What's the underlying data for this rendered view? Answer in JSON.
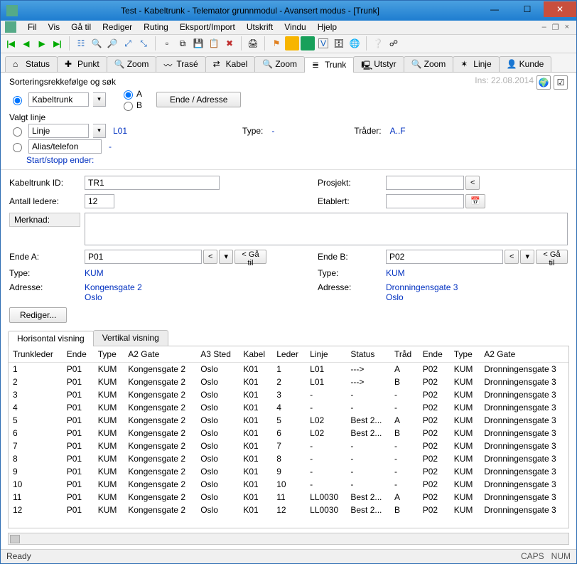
{
  "titlebar": {
    "text": "Test - Kabeltrunk - Telemator grunnmodul - Avansert modus - [Trunk]"
  },
  "menu": [
    "Fil",
    "Vis",
    "Gå til",
    "Rediger",
    "Ruting",
    "Eksport/Import",
    "Utskrift",
    "Vindu",
    "Hjelp"
  ],
  "tabs": [
    {
      "label": "Status"
    },
    {
      "label": "Punkt"
    },
    {
      "label": "Zoom"
    },
    {
      "label": "Trasé"
    },
    {
      "label": "Kabel"
    },
    {
      "label": "Zoom"
    },
    {
      "label": "Trunk",
      "active": true
    },
    {
      "label": "Utstyr"
    },
    {
      "label": "Zoom"
    },
    {
      "label": "Linje"
    },
    {
      "label": "Kunde"
    }
  ],
  "sort": {
    "heading": "Sorteringsrekkefølge og søk",
    "kabeltrunk": "Kabeltrunk",
    "A": "A",
    "B": "B",
    "ende_adresse_btn": "Ende / Adresse",
    "valgt": "Valgt linje",
    "linje": "Linje",
    "linje_val": "L01",
    "alias": "Alias/telefon",
    "alias_val": "-",
    "type_label": "Type:",
    "type_val": "-",
    "trader_label": "Tråder:",
    "trader_val": "A..F",
    "startstopp": "Start/stopp ender:",
    "insert": "Ins: 22.08.2014"
  },
  "form": {
    "kabeltrunk_id_label": "Kabeltrunk ID:",
    "kabeltrunk_id": "TR1",
    "prosjekt_label": "Prosjekt:",
    "prosjekt": "",
    "prosjekt_btn": "<",
    "antall_label": "Antall ledere:",
    "antall": "12",
    "etablert_label": "Etablert:",
    "etablert": "",
    "merknad_label": "Merknad:",
    "merknad": "",
    "endeA_label": "Ende A:",
    "endeA": "P01",
    "ga_til": "< Gå til",
    "lt": "<",
    "dd": "▾",
    "endeB_label": "Ende B:",
    "endeB": "P02",
    "type_label": "Type:",
    "adresse_label": "Adresse:",
    "A_type": "KUM",
    "A_addr1": "Kongensgate 2",
    "A_addr2": "Oslo",
    "B_type": "KUM",
    "B_addr1": "Dronningensgate 3",
    "B_addr2": "Oslo",
    "rediger": "Rediger..."
  },
  "viewtabs": {
    "horisontal": "Horisontal visning",
    "vertikal": "Vertikal visning"
  },
  "columns": [
    "Trunkleder",
    "Ende",
    "Type",
    "A2 Gate",
    "A3 Sted",
    "Kabel",
    "Leder",
    "Linje",
    "Status",
    "Tråd",
    "Ende",
    "Type",
    "A2 Gate"
  ],
  "rows": [
    [
      "1",
      "P01",
      "KUM",
      "Kongensgate 2",
      "Oslo",
      "K01",
      "1",
      "L01",
      "--->",
      "A",
      "P02",
      "KUM",
      "Dronningensgate 3"
    ],
    [
      "2",
      "P01",
      "KUM",
      "Kongensgate 2",
      "Oslo",
      "K01",
      "2",
      "L01",
      "--->",
      "B",
      "P02",
      "KUM",
      "Dronningensgate 3"
    ],
    [
      "3",
      "P01",
      "KUM",
      "Kongensgate 2",
      "Oslo",
      "K01",
      "3",
      "-",
      "-",
      "-",
      "P02",
      "KUM",
      "Dronningensgate 3"
    ],
    [
      "4",
      "P01",
      "KUM",
      "Kongensgate 2",
      "Oslo",
      "K01",
      "4",
      "-",
      "-",
      "-",
      "P02",
      "KUM",
      "Dronningensgate 3"
    ],
    [
      "5",
      "P01",
      "KUM",
      "Kongensgate 2",
      "Oslo",
      "K01",
      "5",
      "L02",
      "Best 2...",
      "A",
      "P02",
      "KUM",
      "Dronningensgate 3"
    ],
    [
      "6",
      "P01",
      "KUM",
      "Kongensgate 2",
      "Oslo",
      "K01",
      "6",
      "L02",
      "Best 2...",
      "B",
      "P02",
      "KUM",
      "Dronningensgate 3"
    ],
    [
      "7",
      "P01",
      "KUM",
      "Kongensgate 2",
      "Oslo",
      "K01",
      "7",
      "-",
      "-",
      "-",
      "P02",
      "KUM",
      "Dronningensgate 3"
    ],
    [
      "8",
      "P01",
      "KUM",
      "Kongensgate 2",
      "Oslo",
      "K01",
      "8",
      "-",
      "-",
      "-",
      "P02",
      "KUM",
      "Dronningensgate 3"
    ],
    [
      "9",
      "P01",
      "KUM",
      "Kongensgate 2",
      "Oslo",
      "K01",
      "9",
      "-",
      "-",
      "-",
      "P02",
      "KUM",
      "Dronningensgate 3"
    ],
    [
      "10",
      "P01",
      "KUM",
      "Kongensgate 2",
      "Oslo",
      "K01",
      "10",
      "-",
      "-",
      "-",
      "P02",
      "KUM",
      "Dronningensgate 3"
    ],
    [
      "11",
      "P01",
      "KUM",
      "Kongensgate 2",
      "Oslo",
      "K01",
      "11",
      "LL0030",
      "Best 2...",
      "A",
      "P02",
      "KUM",
      "Dronningensgate 3"
    ],
    [
      "12",
      "P01",
      "KUM",
      "Kongensgate 2",
      "Oslo",
      "K01",
      "12",
      "LL0030",
      "Best 2...",
      "B",
      "P02",
      "KUM",
      "Dronningensgate 3"
    ]
  ],
  "status": {
    "left": "Ready",
    "caps": "CAPS",
    "num": "NUM"
  }
}
